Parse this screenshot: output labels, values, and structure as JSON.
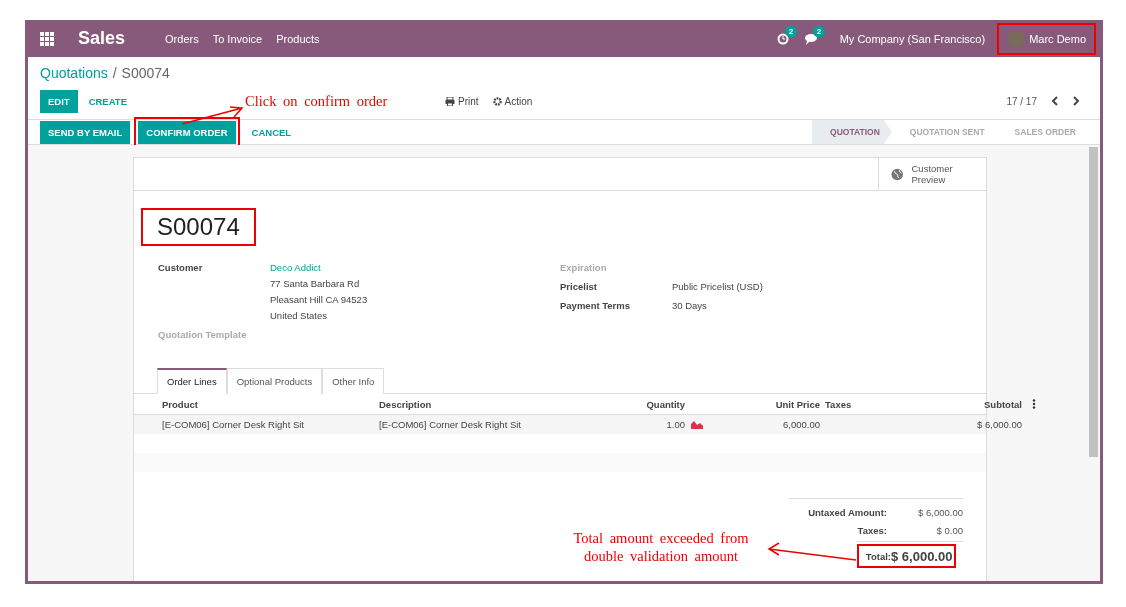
{
  "navbar": {
    "app": "Sales",
    "menu": [
      "Orders",
      "To Invoice",
      "Products"
    ],
    "activity_count": "2",
    "message_count": "2",
    "company": "My Company (San Francisco)",
    "user": "Marc Demo",
    "user_highlighted": true
  },
  "breadcrumb": {
    "parent": "Quotations",
    "separator": "/",
    "current": "S00074"
  },
  "actions": [
    {
      "label": "EDIT",
      "kind": "primary"
    },
    {
      "label": "CREATE",
      "kind": "link"
    }
  ],
  "print": "Print",
  "action": "Action",
  "pager": "17 / 17",
  "status_buttons": [
    {
      "label": "SEND BY EMAIL",
      "kind": "primary",
      "highlighted": false
    },
    {
      "label": "CONFIRM ORDER",
      "kind": "primary",
      "highlighted": true
    },
    {
      "label": "CANCEL",
      "kind": "link",
      "highlighted": false
    }
  ],
  "stages": [
    {
      "label": "QUOTATION",
      "selected": true
    },
    {
      "label": "QUOTATION SENT",
      "selected": false
    },
    {
      "label": "SALES ORDER",
      "selected": false
    }
  ],
  "sheet": {
    "customer_preview": "Customer Preview",
    "name": "S00074",
    "name_highlighted": true,
    "left_fields": [
      {
        "label": "Customer",
        "link": "Deco Addict",
        "lines": [
          "77 Santa Barbara Rd",
          "Pleasant Hill CA 94523",
          "United States"
        ]
      },
      {
        "label": "Quotation Template"
      }
    ],
    "right_fields": [
      {
        "label": "Expiration"
      },
      {
        "label": "Pricelist",
        "lines": [
          "Public Pricelist (USD)"
        ]
      },
      {
        "label": "Payment Terms",
        "lines": [
          "30 Days"
        ]
      }
    ],
    "tabs": [
      {
        "label": "Order Lines",
        "selected": true
      },
      {
        "label": "Optional Products",
        "selected": false
      },
      {
        "label": "Other Info",
        "selected": false
      }
    ],
    "columns": [
      "Product",
      "Description",
      "Quantity",
      "Unit Price",
      "Taxes",
      "Subtotal"
    ],
    "rows": [
      {
        "product": "[E-COM06] Corner Desk Right Sit",
        "description": "[E-COM06] Corner Desk Right Sit",
        "quantity": "1.00",
        "unit_price": "6,000.00",
        "subtotal": "$ 6,000.00"
      }
    ],
    "totals": [
      {
        "label": "Untaxed Amount:",
        "value": "$ 6,000.00"
      },
      {
        "label": "Taxes:",
        "value": "$ 0.00"
      }
    ],
    "total": {
      "label": "Total:",
      "value": "$ 6,000.00",
      "highlighted": true
    }
  },
  "annotations": [
    {
      "text": "Click on confirm order"
    },
    {
      "text": "Total amount exceeded from double validation amount"
    }
  ]
}
